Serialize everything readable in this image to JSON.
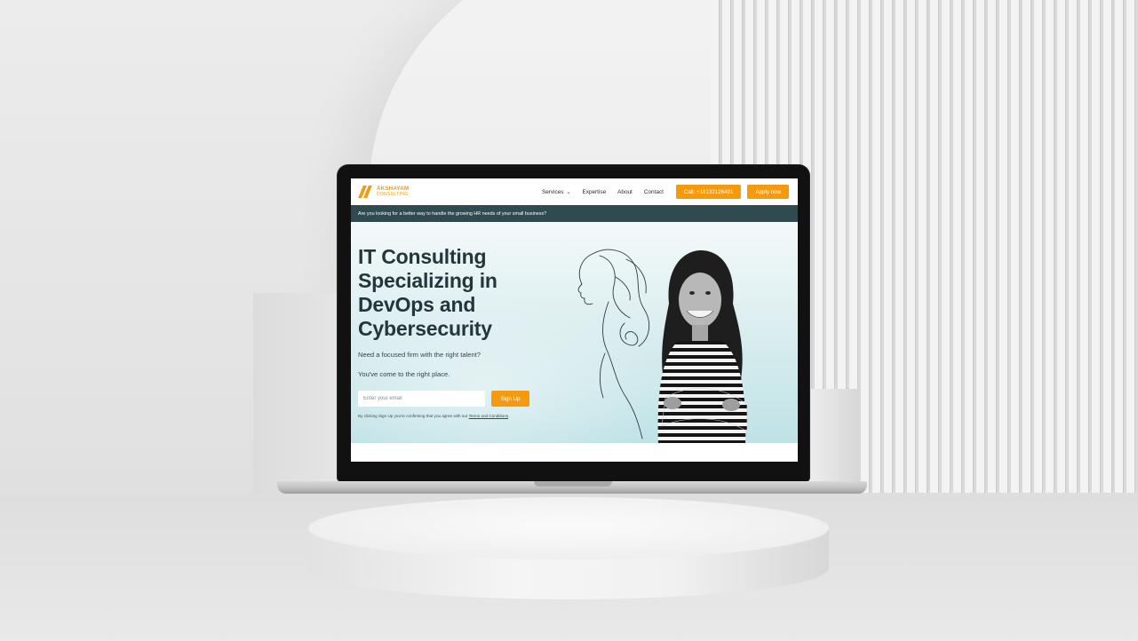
{
  "nav": {
    "logo_line1": "AKSHAYAM",
    "logo_line2": "CONSULTING",
    "items": [
      {
        "label": "Services",
        "has_dropdown": true
      },
      {
        "label": "Expertise"
      },
      {
        "label": "About"
      },
      {
        "label": "Contact"
      }
    ],
    "call_label": "Call: +18132126491",
    "apply_label": "Apply now"
  },
  "promo": {
    "text": "Are you looking for a better way to handle the growing HR needs of your small business?"
  },
  "hero": {
    "title": "IT Consulting Specializing in DevOps and Cybersecurity",
    "subtitle1": "Need a focused firm with the right talent?",
    "subtitle2": "You've come to the right place.",
    "email_placeholder": "Enter your email",
    "signup_label": "Sign Up",
    "terms_prefix": "By clicking Sign Up you're confirming that you agree with our ",
    "terms_link": "Terms and Conditions",
    "terms_suffix": "."
  },
  "colors": {
    "accent": "#f59a0c",
    "promo_bg": "#2f4a51",
    "heading": "#23363b",
    "hero_bg_bottom": "#bfe2e6"
  },
  "icons": {
    "dropdown": "chevron-down-icon",
    "logo": "logo-mark-icon"
  }
}
